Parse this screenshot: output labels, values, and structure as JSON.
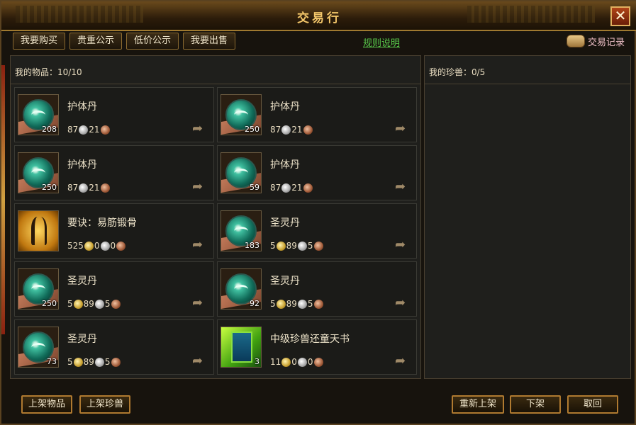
{
  "window": {
    "title": "交易行",
    "close_label": "✕"
  },
  "tabs": [
    {
      "label": "我要购买"
    },
    {
      "label": "贵重公示"
    },
    {
      "label": "低价公示"
    },
    {
      "label": "我要出售"
    }
  ],
  "rules_link": "规则说明",
  "records_label": "交易记录",
  "left_panel": {
    "header": "我的物品：10/10"
  },
  "right_panel": {
    "header": "我的珍兽：0/5"
  },
  "items": [
    {
      "name": "护体丹",
      "icon": "jade-orb-icon",
      "qty": "208",
      "price": {
        "silver": "87",
        "copper": "21"
      }
    },
    {
      "name": "护体丹",
      "icon": "jade-orb-icon",
      "qty": "250",
      "price": {
        "silver": "87",
        "copper": "21"
      }
    },
    {
      "name": "护体丹",
      "icon": "jade-orb-icon",
      "qty": "250",
      "price": {
        "silver": "87",
        "copper": "21"
      }
    },
    {
      "name": "护体丹",
      "icon": "jade-orb-icon",
      "qty": "59",
      "price": {
        "silver": "87",
        "copper": "21"
      }
    },
    {
      "name": "要诀：易筋锻骨",
      "icon": "martial-figure-icon",
      "qty": "",
      "price": {
        "gold": "525",
        "silver": "0",
        "copper": "0"
      }
    },
    {
      "name": "圣灵丹",
      "icon": "jade-orb-icon",
      "qty": "183",
      "price": {
        "gold": "5",
        "silver": "89",
        "copper": "5"
      }
    },
    {
      "name": "圣灵丹",
      "icon": "jade-orb-icon",
      "qty": "250",
      "price": {
        "gold": "5",
        "silver": "89",
        "copper": "5"
      }
    },
    {
      "name": "圣灵丹",
      "icon": "jade-orb-icon",
      "qty": "92",
      "price": {
        "gold": "5",
        "silver": "89",
        "copper": "5"
      }
    },
    {
      "name": "圣灵丹",
      "icon": "jade-orb-icon",
      "qty": "73",
      "price": {
        "gold": "5",
        "silver": "89",
        "copper": "5"
      }
    },
    {
      "name": "中级珍兽还童天书",
      "icon": "skill-book-icon",
      "qty": "3",
      "price": {
        "gold": "11",
        "silver": "0",
        "copper": "0"
      }
    }
  ],
  "buttons": {
    "list_item": "上架物品",
    "list_pet": "上架珍兽",
    "relist": "重新上架",
    "unlist": "下架",
    "cancel": "取回"
  }
}
